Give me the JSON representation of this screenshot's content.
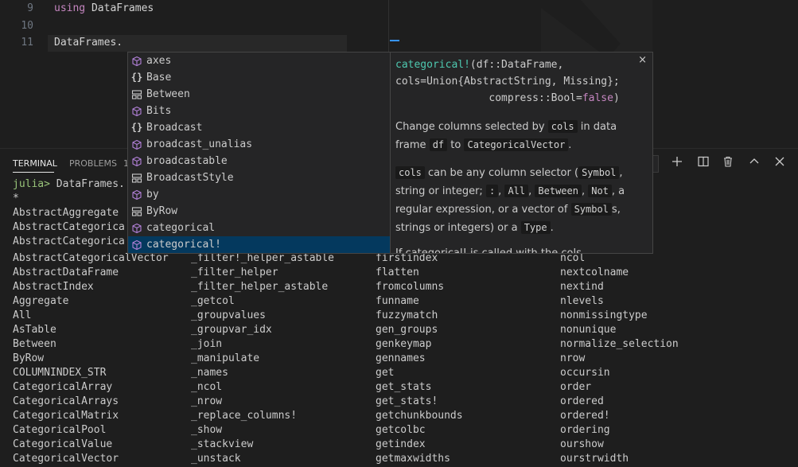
{
  "editor": {
    "lines": [
      {
        "num": "9",
        "kw": "using",
        "rest": " DataFrames"
      },
      {
        "num": "10",
        "kw": "",
        "rest": ""
      },
      {
        "num": "11",
        "kw": "",
        "rest": "DataFrames."
      }
    ]
  },
  "panel": {
    "tabs": [
      "TERMINAL",
      "PROBLEMS",
      "1"
    ],
    "buttons": [
      "add-icon",
      "split-icon",
      "trash-icon",
      "chevron-up-icon",
      "close-icon"
    ]
  },
  "terminal": {
    "prompt": "julia>",
    "command": " DataFrames.",
    "lines_before": [
      "*",
      "AbstractAggregate",
      "AbstractCategorica",
      "AbstractCategorica"
    ],
    "columns": [
      [
        "AbstractCategoricalVector",
        "AbstractDataFrame",
        "AbstractIndex",
        "Aggregate",
        "All",
        "AsTable",
        "Between",
        "ByRow",
        "COLUMNINDEX_STR",
        "CategoricalArray",
        "CategoricalArrays",
        "CategoricalMatrix",
        "CategoricalPool",
        "CategoricalValue",
        "CategoricalVector"
      ],
      [
        "_filter!_helper_astable",
        "_filter_helper",
        "_filter_helper_astable",
        "_getcol",
        "_groupvalues",
        "_groupvar_idx",
        "_join",
        "_manipulate",
        "_names",
        "_ncol",
        "_nrow",
        "_replace_columns!",
        "_show",
        "_stackview",
        "_unstack"
      ],
      [
        "firstindex",
        "flatten",
        "fromcolumns",
        "funname",
        "fuzzymatch",
        "gen_groups",
        "genkeymap",
        "gennames",
        "get",
        "get_stats",
        "get_stats!",
        "getchunkbounds",
        "getcolbc",
        "getindex",
        "getmaxwidths"
      ],
      [
        "ncol",
        "nextcolname",
        "nextind",
        "nlevels",
        "nonmissingtype",
        "nonunique",
        "normalize_selection",
        "nrow",
        "occursin",
        "order",
        "ordered",
        "ordered!",
        "ordering",
        "ourshow",
        "ourstrwidth"
      ]
    ]
  },
  "suggest": {
    "items": [
      {
        "label": "axes",
        "icon": "cube-icon"
      },
      {
        "label": "Base",
        "icon": "braces-icon"
      },
      {
        "label": "Between",
        "icon": "struct-icon"
      },
      {
        "label": "Bits",
        "icon": "cube-icon"
      },
      {
        "label": "Broadcast",
        "icon": "braces-icon"
      },
      {
        "label": "broadcast_unalias",
        "icon": "cube-icon"
      },
      {
        "label": "broadcastable",
        "icon": "cube-icon"
      },
      {
        "label": "BroadcastStyle",
        "icon": "struct-icon"
      },
      {
        "label": "by",
        "icon": "cube-icon"
      },
      {
        "label": "ByRow",
        "icon": "struct-icon"
      },
      {
        "label": "categorical",
        "icon": "cube-icon"
      },
      {
        "label": "categorical!",
        "icon": "cube-icon"
      }
    ],
    "selected_index": 11
  },
  "docs": {
    "sig_fn": "categorical!",
    "sig_line1_rest": "(df::DataFrame,",
    "sig_line2": "cols=Union{AbstractString, Missing};",
    "sig_line3_pre": "               compress::Bool=",
    "sig_line3_false": "false",
    "sig_line3_post": ")",
    "close": "×",
    "p1": {
      "t1": "Change columns selected by ",
      "c1": "cols",
      "t2": " in data frame ",
      "c2": "df",
      "t3": " to ",
      "c3": "CategoricalVector",
      "t4": "."
    },
    "p2": {
      "c1": "cols",
      "t1": " can be any column selector (",
      "c2": "Symbol",
      "t2": ", string or integer; ",
      "c3": ":",
      "t3": ", ",
      "c4": "All",
      "t4": ", ",
      "c5": "Between",
      "t5": ", ",
      "c6": "Not",
      "t6": ", a regular expression, or a vector of ",
      "c7": "Symbol",
      "t7": "s, strings or integers) or a ",
      "c8": "Type",
      "t8": "."
    },
    "p3": "If categorical! is called with the cols"
  }
}
